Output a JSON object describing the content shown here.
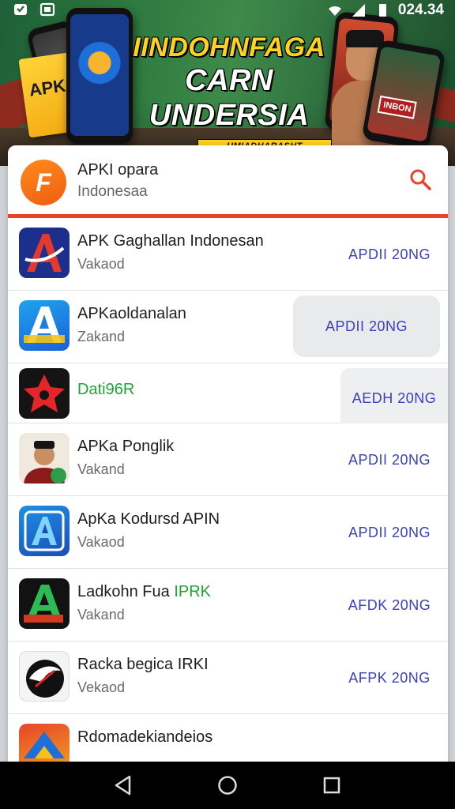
{
  "status_bar": {
    "time": "024.34"
  },
  "banner": {
    "headline_line1": "IINDOHNFAGA",
    "headline_line2": "CARN UNDERSIA",
    "tagline": "UMIADHARASHT MASIASLE",
    "box_label": "APK",
    "phone_badge": "INBON"
  },
  "header": {
    "logo_glyph": "F",
    "title": "APKI opara",
    "subtitle": "Indonesaa"
  },
  "apps": [
    {
      "name": "APK Gaghallan Indonesan",
      "developer": "Vakaod",
      "action": "APDII 20NG",
      "icon": "apk-a-icon"
    },
    {
      "name": "APKaoldanalan",
      "developer": "Zakand",
      "action": "APDII 20NG",
      "icon": "apk-blue-a-icon"
    },
    {
      "name_accent": "Dati96R",
      "action": "AEDH 20NG",
      "icon": "star-logo-icon"
    },
    {
      "name": "APKa Ponglik",
      "developer": "Vakand",
      "action": "APDII 20NG",
      "icon": "person-avatar-icon"
    },
    {
      "name": "ApKa Kodursd APIN",
      "developer": "Vakaod",
      "action": "APDII 20NG",
      "icon": "apk-blue-a-icon"
    },
    {
      "name": "Ladkohn Fua",
      "name_accent": "IPRK",
      "developer": "Vakand",
      "action": "AFDK 20NG",
      "icon": "green-a-icon"
    },
    {
      "name": "Racka begica IRKI",
      "developer": "Vekaod",
      "action": "AFPK 20NG",
      "icon": "emblem-icon"
    },
    {
      "name": "Rdomadekiandeios",
      "developer": "",
      "action": "",
      "icon": "colorful-a-icon"
    }
  ]
}
